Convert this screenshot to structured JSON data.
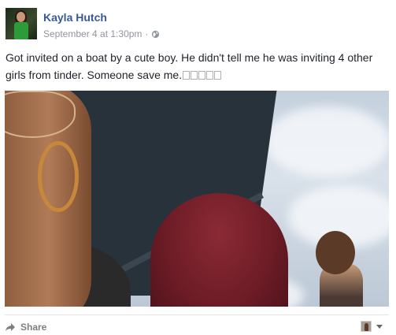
{
  "post": {
    "author": "Kayla Hutch",
    "timestamp": "September 4 at 1:30pm",
    "separator": "·",
    "privacy_icon": "globe-icon",
    "caption": "Got invited on a boat by a cute boy. He didn't tell me he was inviting 4 other girls from tinder. Someone save me.",
    "emoji_placeholders": 5,
    "photo_alt": ""
  },
  "footer": {
    "share_label": "Share",
    "share_icon": "share-arrow-icon",
    "viewer_icon": "profile-thumbnail",
    "menu_icon": "caret-down-icon"
  },
  "colors": {
    "author_link": "#365899",
    "meta_text": "#90949c",
    "body_text": "#1d2129",
    "footer_text": "#7f7f7f"
  }
}
